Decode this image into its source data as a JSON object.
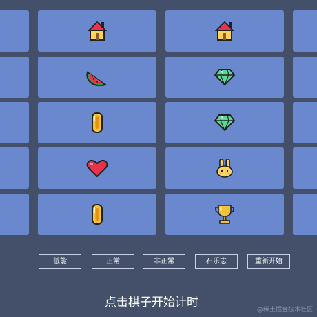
{
  "board": {
    "columns": [
      [
        "",
        "",
        "",
        "",
        ""
      ],
      [
        "house",
        "watermelon",
        "coin",
        "heart",
        "coin"
      ],
      [
        "house",
        "gem",
        "gem",
        "bunny",
        "trophy"
      ],
      [
        "",
        "",
        "",
        "",
        ""
      ]
    ]
  },
  "icons": {
    "house": "house-icon",
    "watermelon": "watermelon-icon",
    "coin": "coin-icon",
    "heart": "heart-icon",
    "gem": "gem-icon",
    "bunny": "bunny-icon",
    "trophy": "trophy-icon"
  },
  "controls": {
    "low": "低能",
    "normal": "正常",
    "abnormal": "非正常",
    "stone": "石乐志",
    "restart": "重新开始"
  },
  "status": {
    "message": "点击棋子开始计时"
  },
  "watermark": "@稀土掘金技术社区",
  "colors": {
    "background": "#445069",
    "tile": "#6a88cd"
  }
}
